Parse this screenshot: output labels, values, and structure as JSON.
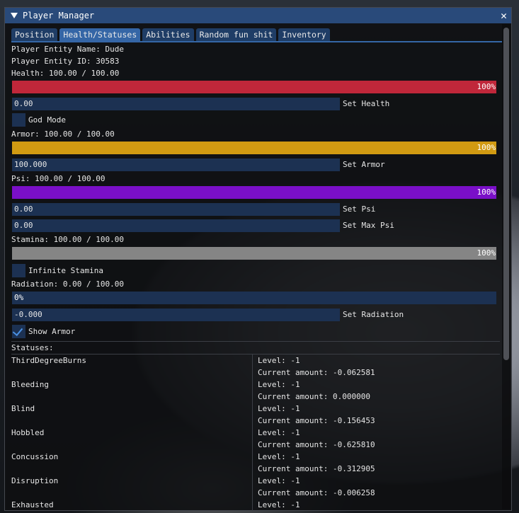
{
  "window": {
    "title": "Player Manager",
    "close_glyph": "✕"
  },
  "tabs": [
    "Position",
    "Health/Statuses",
    "Abilities",
    "Random fun shit",
    "Inventory"
  ],
  "player": {
    "name_line": "Player Entity Name: Dude",
    "id_line": "Player Entity ID: 30583"
  },
  "health": {
    "label": "Health: 100.00 / 100.00",
    "percent": "100%",
    "fill": 1.0,
    "color": "#c0273a",
    "input": "0.00",
    "button": "Set Health"
  },
  "god_mode": {
    "label": "God Mode",
    "checked": false
  },
  "armor": {
    "label": "Armor: 100.00 / 100.00",
    "percent": "100%",
    "fill": 1.0,
    "color": "#d19a12",
    "input": "100.000",
    "button": "Set Armor"
  },
  "psi": {
    "label": "Psi: 100.00 / 100.00",
    "percent": "100%",
    "fill": 1.0,
    "color": "#7a0fc8",
    "input": "0.00",
    "button": "Set Psi",
    "max_input": "0.00",
    "max_button": "Set Max Psi"
  },
  "stamina": {
    "label": "Stamina: 100.00 / 100.00",
    "percent": "100%",
    "fill": 1.0,
    "color": "#858585"
  },
  "infinite_stamina": {
    "label": "Infinite Stamina",
    "checked": false
  },
  "radiation": {
    "label": "Radiation: 0.00 / 100.00",
    "percent": "0%",
    "fill": 0.0,
    "input": "-0.000",
    "button": "Set Radiation"
  },
  "show_armor": {
    "label": "Show Armor",
    "checked": true
  },
  "statuses": {
    "header": "Statuses:",
    "items": [
      {
        "name": "ThirdDegreeBurns",
        "level": "Level: -1",
        "amount": "Current amount: -0.062581"
      },
      {
        "name": "Bleeding",
        "level": "Level: -1",
        "amount": "Current amount: 0.000000"
      },
      {
        "name": "Blind",
        "level": "Level: -1",
        "amount": "Current amount: -0.156453"
      },
      {
        "name": "Hobbled",
        "level": "Level: -1",
        "amount": "Current amount: -0.625810"
      },
      {
        "name": "Concussion",
        "level": "Level: -1",
        "amount": "Current amount: -0.312905"
      },
      {
        "name": "Disruption",
        "level": "Level: -1",
        "amount": "Current amount: -0.006258"
      },
      {
        "name": "Exhausted",
        "level": "Level: -1",
        "amount": ""
      }
    ]
  }
}
